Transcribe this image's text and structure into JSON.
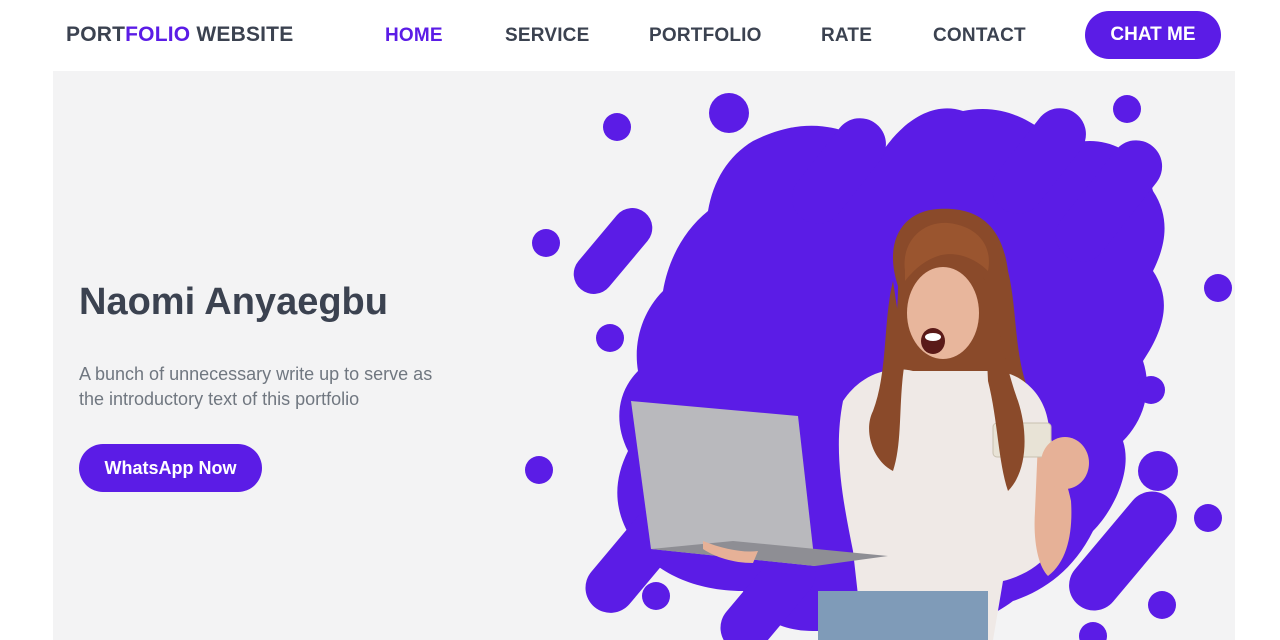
{
  "brand": {
    "part1": "PORT",
    "part2": "FOLIO",
    "part3": " WEBSITE"
  },
  "nav": {
    "items": [
      {
        "label": "HOME",
        "active": true
      },
      {
        "label": "SERVICE",
        "active": false
      },
      {
        "label": "PORTFOLIO",
        "active": false
      },
      {
        "label": "RATE",
        "active": false
      },
      {
        "label": "CONTACT",
        "active": false
      }
    ],
    "cta_label": "CHAT ME"
  },
  "hero": {
    "name": "Naomi Anyaegbu",
    "intro_line1": "A bunch of unnecessary write up to serve as",
    "intro_line2": "the introductory text of this portfolio",
    "button_label": "WhatsApp Now"
  },
  "colors": {
    "accent": "#5b1ce6",
    "text": "#3b4250",
    "muted": "#707780",
    "hero_bg": "#f3f3f4"
  }
}
